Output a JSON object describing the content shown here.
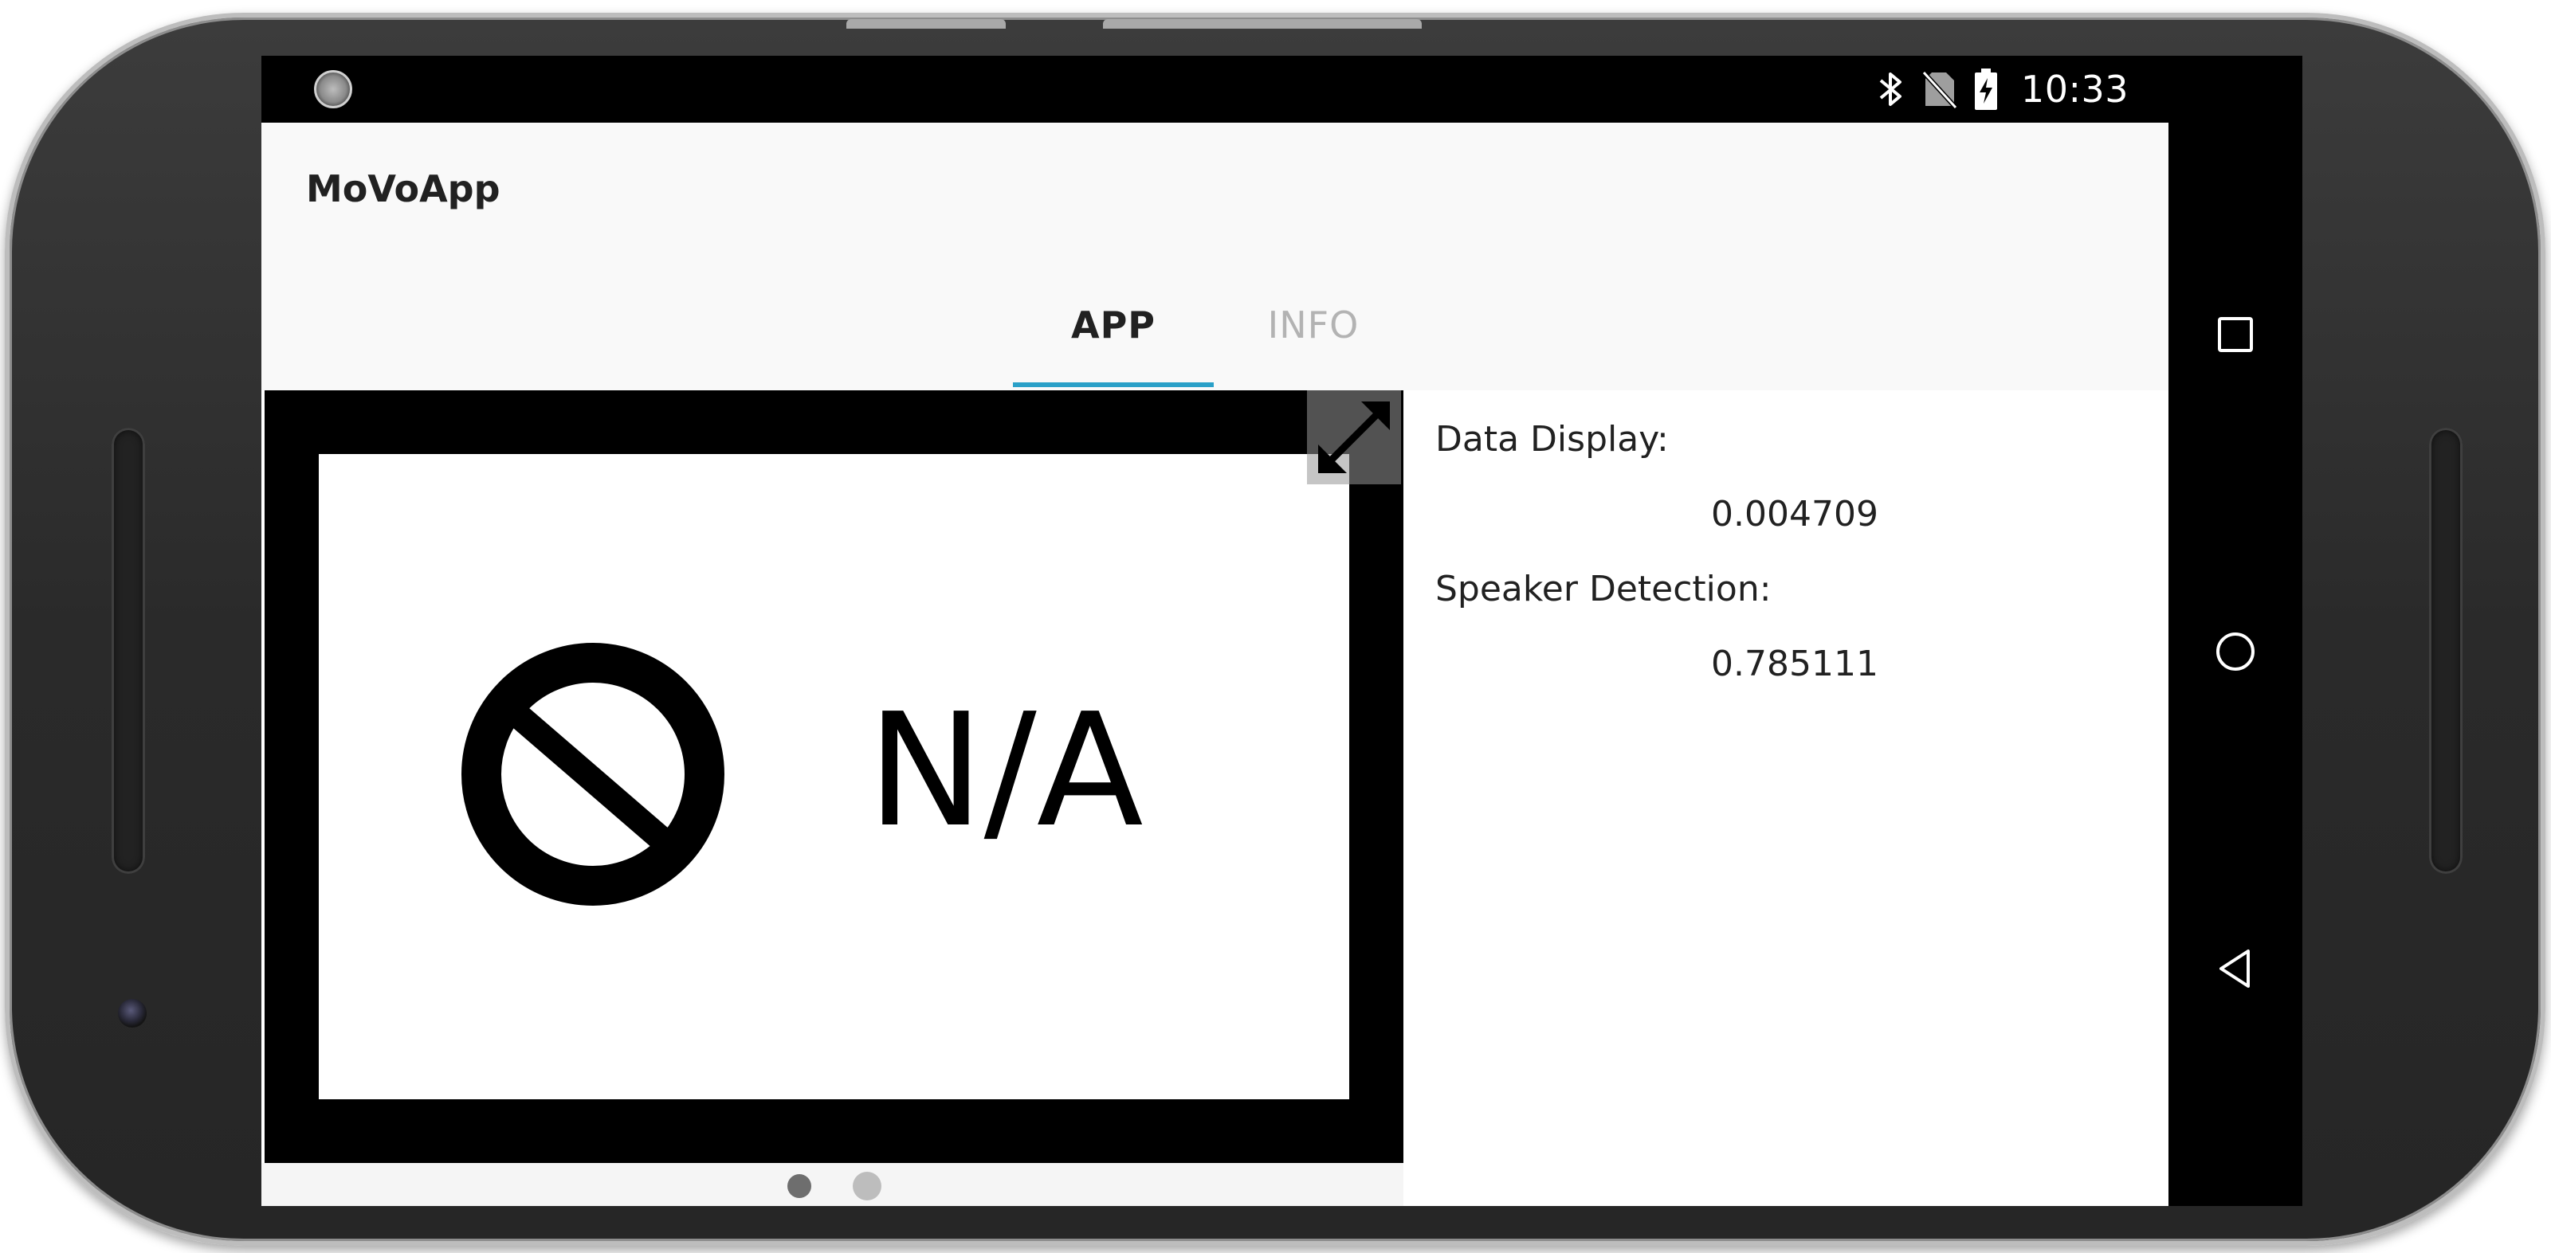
{
  "status_bar": {
    "time": "10:33",
    "icons": [
      "bluetooth-icon",
      "no-sim-icon",
      "battery-charging-icon"
    ]
  },
  "app": {
    "title": "MoVoApp",
    "tabs": [
      {
        "label": "APP",
        "selected": true
      },
      {
        "label": "INFO",
        "selected": false
      }
    ],
    "video": {
      "placeholder_text": "N/A",
      "placeholder_icon": "prohibited-icon",
      "expand_icon": "expand-icon"
    },
    "pager": {
      "pages": 2,
      "current": 1
    },
    "data_panel": {
      "data_display_label": "Data Display:",
      "data_display_value": "0.004709",
      "speaker_detection_label": "Speaker Detection:",
      "speaker_detection_value": "0.785111"
    }
  },
  "nav_bar": {
    "buttons": [
      "recents-icon",
      "home-icon",
      "back-icon"
    ]
  },
  "colors": {
    "tab_indicator": "#2aa0c8",
    "appbar_background": "#f9f9f9",
    "inactive_tab": "#b3b3b3"
  }
}
